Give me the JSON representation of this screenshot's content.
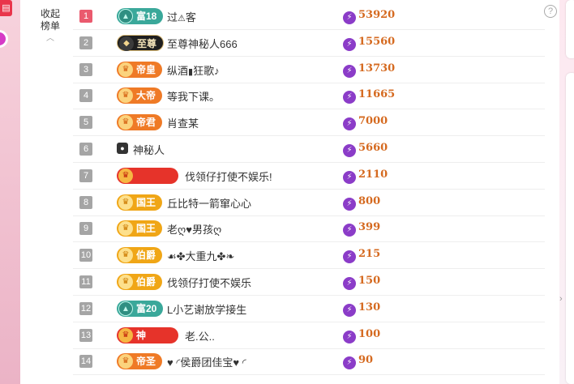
{
  "collapse_label": "收起榜单",
  "rows": [
    {
      "rank": "1",
      "badge": "富18",
      "medal": "▲",
      "style": "b-green",
      "name": "过",
      "name_icon": "⚠",
      "name_suffix": "客",
      "score": "53920"
    },
    {
      "rank": "2",
      "badge": "至尊",
      "medal": "◆",
      "style": "b-dark",
      "name": "至尊神秘人666",
      "name_icon": "",
      "name_suffix": "",
      "score": "15560"
    },
    {
      "rank": "3",
      "badge": "帝皇",
      "medal": "♛",
      "style": "b-orange",
      "name": "纵酒",
      "name_icon": "▮",
      "name_suffix": "狂歌♪",
      "score": "13730"
    },
    {
      "rank": "4",
      "badge": "大帝",
      "medal": "♛",
      "style": "b-orange",
      "name": "等我下课。",
      "name_icon": "",
      "name_suffix": "",
      "score": "11665"
    },
    {
      "rank": "5",
      "badge": "帝君",
      "medal": "♛",
      "style": "b-orange",
      "name": "肖查某",
      "name_icon": "",
      "name_suffix": "",
      "score": "7000"
    },
    {
      "rank": "6",
      "badge": "",
      "medal": "",
      "style": "none",
      "name": "神秘人",
      "name_icon": "",
      "name_suffix": "",
      "score": "5660"
    },
    {
      "rank": "7",
      "badge": "",
      "medal": "♛",
      "style": "b-red",
      "name": "伐领仔打使不娱乐!",
      "name_icon": "",
      "name_suffix": "",
      "score": "2110"
    },
    {
      "rank": "8",
      "badge": "国王",
      "medal": "♛",
      "style": "b-gold",
      "name": "丘比特一箭窜心心",
      "name_icon": "",
      "name_suffix": "",
      "score": "800"
    },
    {
      "rank": "9",
      "badge": "国王",
      "medal": "♛",
      "style": "b-gold",
      "name": "老ღ♥男孩ღ",
      "name_icon": "",
      "name_suffix": "",
      "score": "399"
    },
    {
      "rank": "10",
      "badge": "伯爵",
      "medal": "♛",
      "style": "b-gold",
      "name": "☙✤大重九✤❧",
      "name_icon": "",
      "name_suffix": "",
      "score": "215"
    },
    {
      "rank": "11",
      "badge": "伯爵",
      "medal": "♛",
      "style": "b-gold",
      "name": "伐领仔打使不娱乐",
      "name_icon": "",
      "name_suffix": "",
      "score": "150"
    },
    {
      "rank": "12",
      "badge": "富20",
      "medal": "▲",
      "style": "b-green",
      "name": "L小艺谢放学接生",
      "name_icon": "",
      "name_suffix": "",
      "score": "130"
    },
    {
      "rank": "13",
      "badge": "神",
      "medal": "♛",
      "style": "b-red",
      "name": "老.公..",
      "name_icon": "",
      "name_suffix": "",
      "score": "100"
    },
    {
      "rank": "14",
      "badge": "帝圣",
      "medal": "♛",
      "style": "b-orange",
      "name": "♥ ◜侯爵团佳宝♥ ◜",
      "name_icon": "",
      "name_suffix": "",
      "score": "90"
    }
  ],
  "colors": {
    "accent": "#d56a20",
    "bolt": "#8b3cc8",
    "first_rank": "#ea5a6e"
  },
  "icons": {
    "help": "question-circle-icon",
    "bolt": "lightning-icon",
    "collapse": "chevron-up-icon"
  }
}
